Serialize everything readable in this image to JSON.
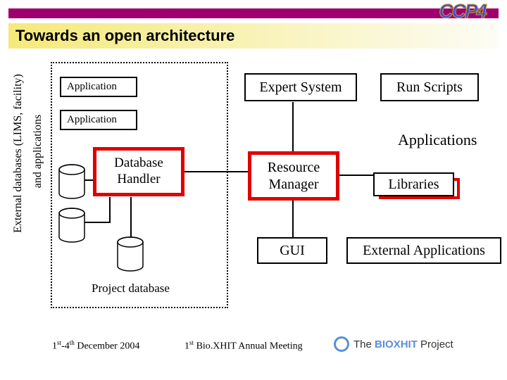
{
  "title": "Towards an open architecture",
  "logo": "CCP4",
  "side_label_outer": "External databases (LIMS, facility)",
  "side_label_inner": "and applications",
  "boxes": {
    "app1": "Application",
    "app2": "Application",
    "db_handler": "Database Handler",
    "project_db": "Project database",
    "expert": "Expert System",
    "run_scripts": "Run Scripts",
    "applications": "Applications",
    "resource_mgr": "Resource Manager",
    "libraries": "Libraries",
    "gui": "GUI",
    "ext_apps": "External Applications"
  },
  "footer": {
    "date_html": "1<sup>st</sup>-4<sup>th</sup> December 2004",
    "date": "1st-4th December 2004",
    "meeting_html": "1<sup>st</sup> Bio.XHIT Annual Meeting",
    "meeting": "1st Bio.XHIT Annual Meeting",
    "project_prefix": "The ",
    "project_bio": "BIOXHIT",
    "project_suffix": " Project"
  }
}
